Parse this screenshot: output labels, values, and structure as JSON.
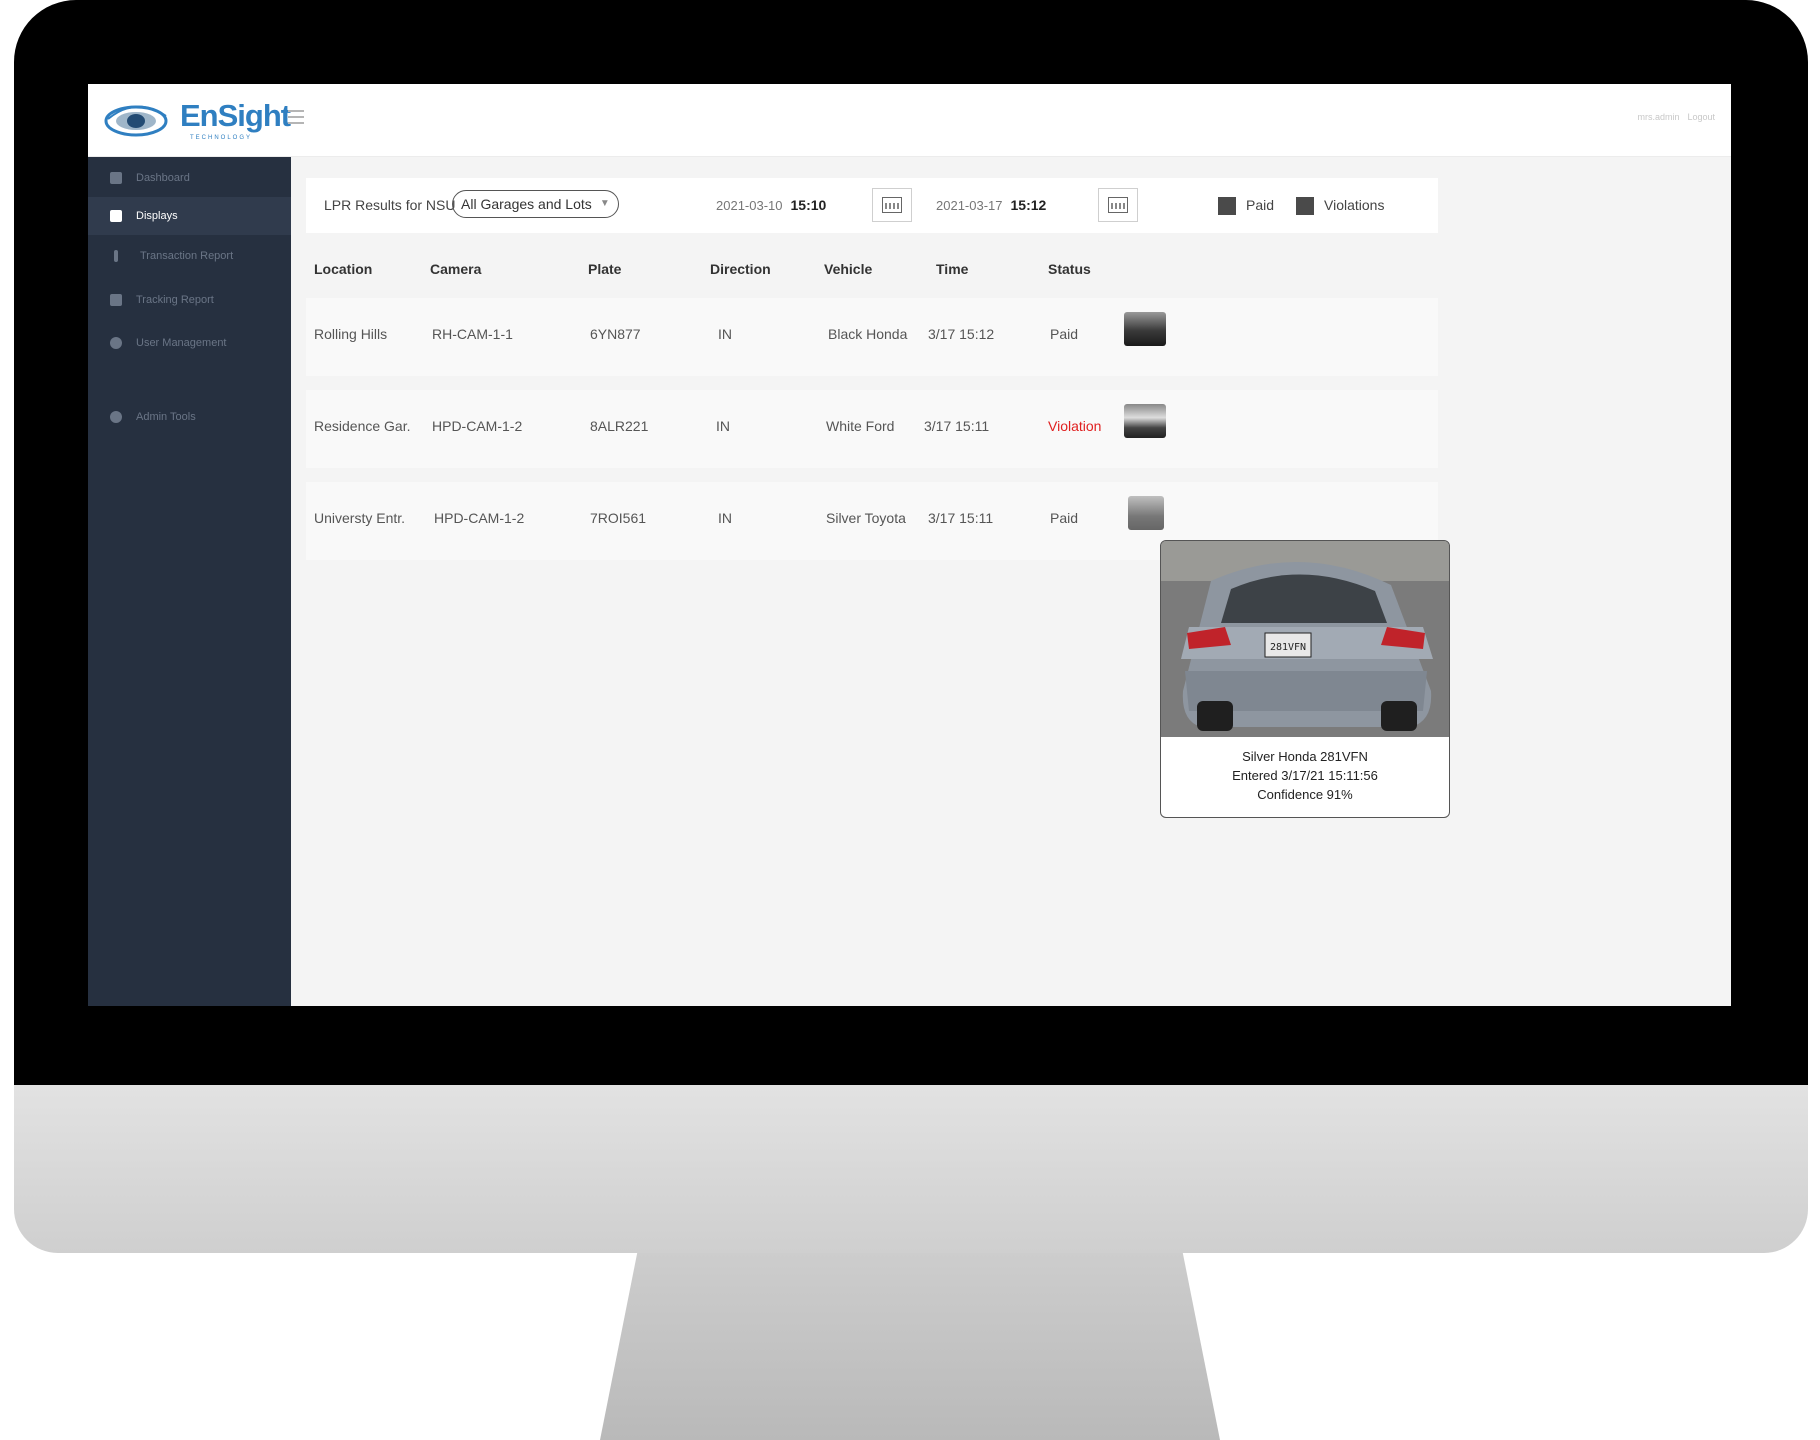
{
  "app": {
    "logo_text": "EnSight",
    "logo_sub": "TECHNOLOGY"
  },
  "header": {
    "user_label": "mrs.admin",
    "logout_label": "Logout"
  },
  "sidebar": {
    "items": [
      {
        "label": "Dashboard",
        "icon": "dashboard-icon"
      },
      {
        "label": "Displays",
        "icon": "displays-icon"
      },
      {
        "label": "Transaction Report",
        "icon": "transaction-icon"
      },
      {
        "label": "Tracking Report",
        "icon": "tracking-icon"
      },
      {
        "label": "User Management",
        "icon": "users-icon"
      },
      {
        "label": "Admin Tools",
        "icon": "gear-icon"
      }
    ]
  },
  "filter": {
    "label": "LPR Results for NSU",
    "select_value": "All Garages and Lots",
    "start_date": "2021-03-10",
    "start_time": "15:10",
    "end_date": "2021-03-17",
    "end_time": "15:12",
    "legend": {
      "paid": "Paid",
      "violations": "Violations"
    }
  },
  "table": {
    "headers": [
      "Location",
      "Camera",
      "Plate",
      "Direction",
      "Vehicle",
      "Time",
      "Status"
    ],
    "rows": [
      {
        "location": "Rolling Hills",
        "camera": "RH-CAM-1-1",
        "plate": "6YN877",
        "direction": "IN",
        "vehicle": "Black Honda",
        "time": "3/17 15:12",
        "status": "Paid"
      },
      {
        "location": "Residence Gar.",
        "camera": "HPD-CAM-1-2",
        "plate": "8ALR221",
        "direction": "IN",
        "vehicle": "White Ford",
        "time": "3/17 15:11",
        "status": "Violation"
      },
      {
        "location": "Universty Entr.",
        "camera": "HPD-CAM-1-2",
        "plate": "7ROI561",
        "direction": "IN",
        "vehicle": "Silver Toyota",
        "time": "3/17 15:11",
        "status": "Paid"
      }
    ]
  },
  "popup": {
    "line1": "Silver Honda 281VFN",
    "line2": "Entered 3/17/21 15:11:56",
    "line3": "Confidence 91%",
    "plate_text": "281VFN"
  }
}
